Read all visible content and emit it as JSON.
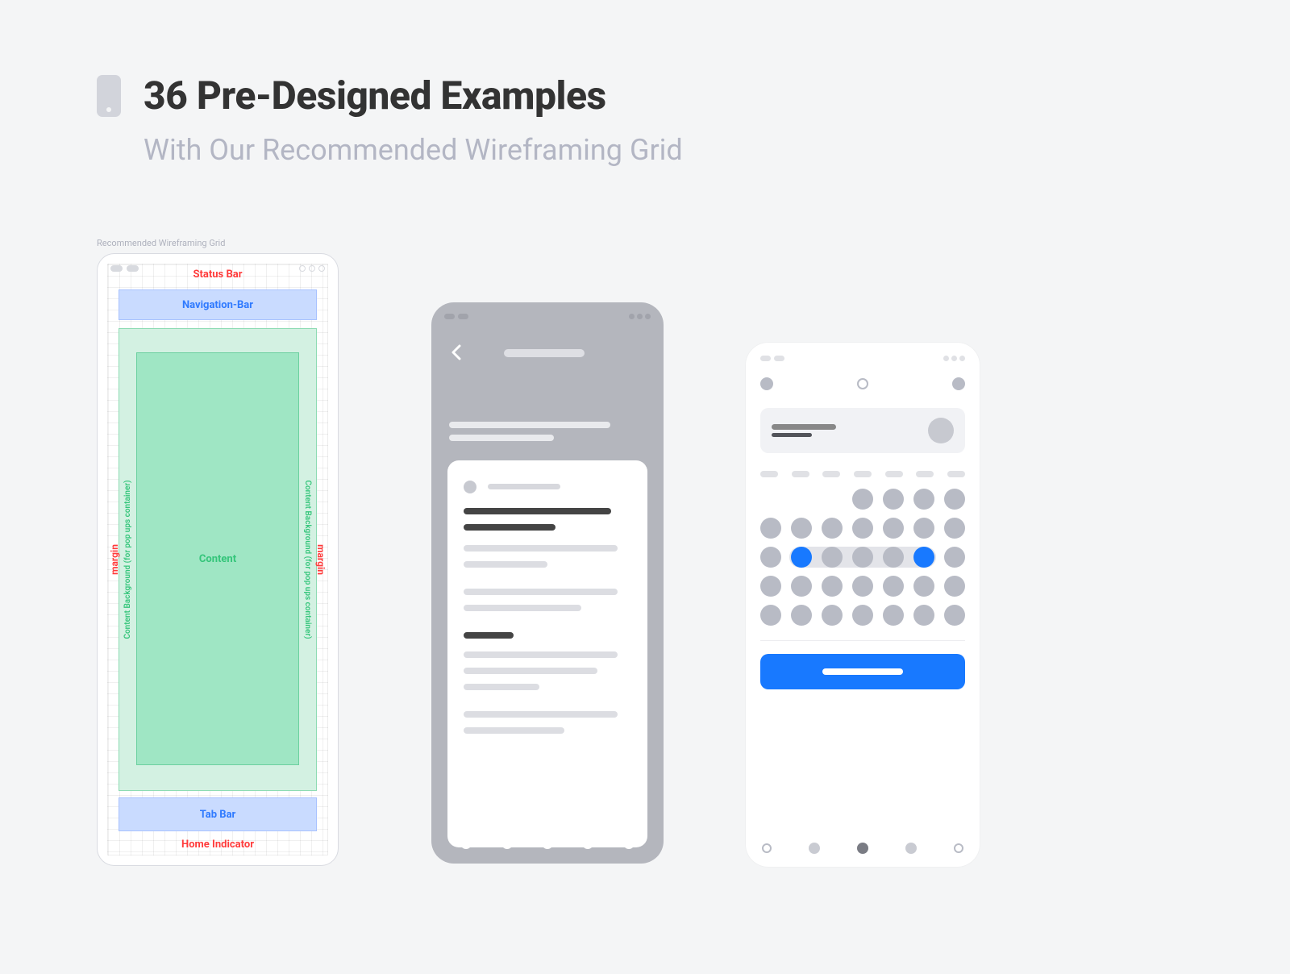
{
  "header": {
    "title": "36 Pre-Designed Examples",
    "subtitle": "With Our Recommended Wireframing Grid"
  },
  "mockup1": {
    "caption": "Recommended Wireframing Grid",
    "labels": {
      "status_bar": "Status Bar",
      "navigation_bar": "Navigation-Bar",
      "content": "Content",
      "content_bg": "Content Background (for pop ups container)",
      "margin": "margin",
      "tab_bar": "Tab Bar",
      "home_indicator": "Home Indicator"
    }
  }
}
